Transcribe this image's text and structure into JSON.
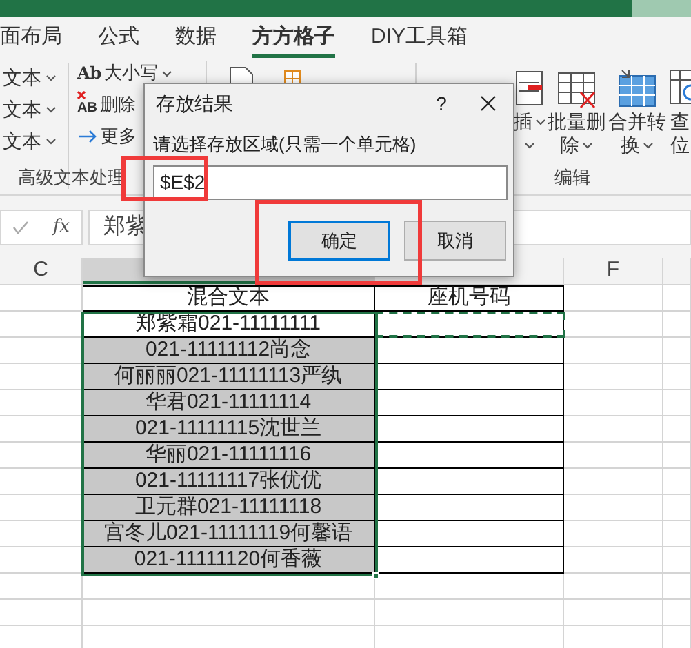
{
  "tabs": [
    {
      "label": "面布局",
      "selected": false
    },
    {
      "label": "公式",
      "selected": false
    },
    {
      "label": "数据",
      "selected": false
    },
    {
      "label": "方方格子",
      "selected": true
    },
    {
      "label": "DIY工具箱",
      "selected": false
    }
  ],
  "ribbon": {
    "text_items": [
      {
        "label": "文本"
      },
      {
        "label": "文本"
      },
      {
        "label": "文本"
      }
    ],
    "tool_items": [
      {
        "kind": "case",
        "icon_text": "Ab",
        "label": "大小写"
      },
      {
        "kind": "delete",
        "icon_text": "AB",
        "label": "删除"
      },
      {
        "kind": "more",
        "label": "更多"
      }
    ],
    "text_group_label": "高级文本处理",
    "edit_buttons": [
      {
        "kind": "insert",
        "lines": [
          "插"
        ]
      },
      {
        "kind": "delete",
        "lines": [
          "批量删",
          "除"
        ]
      },
      {
        "kind": "merge",
        "lines": [
          "合并转",
          "换"
        ]
      },
      {
        "kind": "find",
        "lines": [
          "查",
          "位"
        ]
      }
    ],
    "edit_group_label": "编辑"
  },
  "formula_bar": {
    "fx_label": "fx",
    "value": "郑紫"
  },
  "columns": [
    {
      "label": "C",
      "selected": false
    },
    {
      "selected": true
    },
    {
      "selected": false
    },
    {
      "label": "F",
      "selected": false
    }
  ],
  "table": {
    "headers": [
      "混合文本",
      "座机号码"
    ],
    "rows": [
      {
        "text": "郑紫霜021-11111111",
        "shaded": false
      },
      {
        "text": "021-11111112尚念",
        "shaded": true
      },
      {
        "text": "何丽丽021-11111113严纨",
        "shaded": true
      },
      {
        "text": "华君021-11111114",
        "shaded": true
      },
      {
        "text": "021-11111115沈世兰",
        "shaded": true
      },
      {
        "text": "华丽021-11111116",
        "shaded": true
      },
      {
        "text": "021-11111117张优优",
        "shaded": true
      },
      {
        "text": "卫元群021-11111118",
        "shaded": true
      },
      {
        "text": "宫冬儿021-11111119何馨语",
        "shaded": true
      },
      {
        "text": "021-11111120何香薇",
        "shaded": true
      }
    ]
  },
  "dialog": {
    "title": "存放结果",
    "help": "?",
    "prompt": "请选择存放区域(只需一个单元格)",
    "value": "$E$2",
    "buttons": [
      {
        "label": "确定",
        "default": true
      },
      {
        "label": "取消",
        "default": false
      }
    ]
  }
}
